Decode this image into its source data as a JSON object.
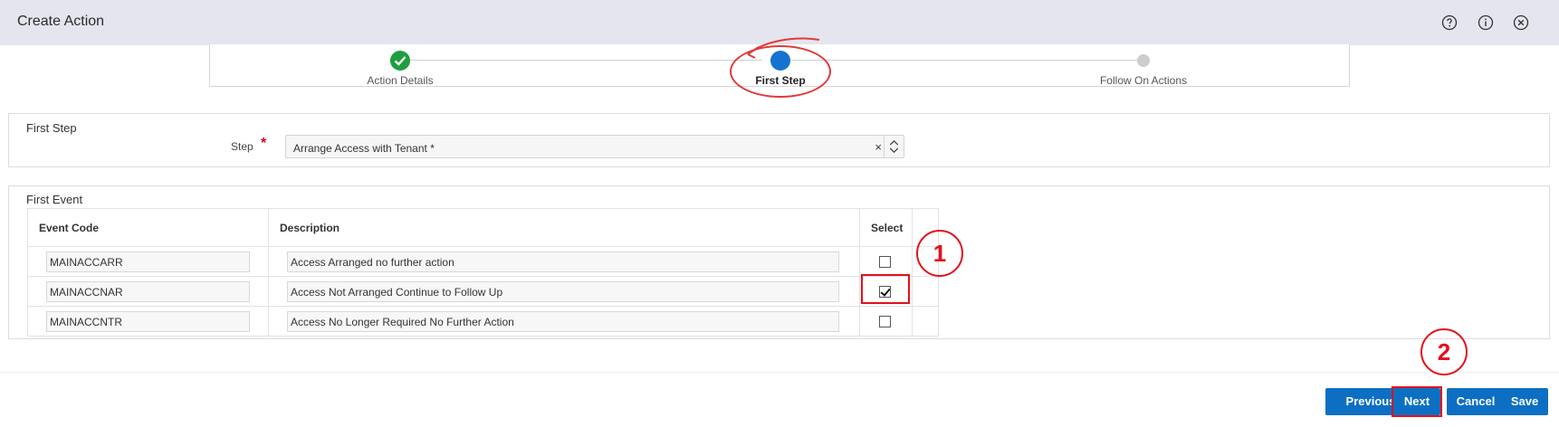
{
  "header": {
    "title": "Create Action",
    "icons": [
      "help-icon",
      "info-icon",
      "close-icon"
    ]
  },
  "train": {
    "stops": [
      {
        "label": "Action Details",
        "state": "completed",
        "icon": "check-icon"
      },
      {
        "label": "First Step",
        "state": "current"
      },
      {
        "label": "Follow On Actions",
        "state": "pending"
      }
    ]
  },
  "first_step": {
    "title": "First Step",
    "step_label": "Step",
    "required_mark": "*",
    "step_value": "Arrange Access with Tenant *",
    "clear_glyph": "×"
  },
  "first_event": {
    "title": "First Event",
    "columns": [
      "Event Code",
      "Description",
      "Select"
    ],
    "rows": [
      {
        "code": "MAINACCARR",
        "description": "Access Arranged no further action",
        "selected": false
      },
      {
        "code": "MAINACCNAR",
        "description": "Access Not Arranged Continue to Follow Up",
        "selected": true
      },
      {
        "code": "MAINACCNTR",
        "description": "Access No Longer Required No Further Action",
        "selected": false
      }
    ]
  },
  "annotations": {
    "callout_1": "1",
    "callout_2": "2",
    "color": "#e3101b"
  },
  "footer": {
    "previous_label": "Previous",
    "next_label": "Next",
    "cancel_label": "Cancel",
    "save_label": "Save"
  },
  "colors": {
    "header_bg": "#e4e5ee",
    "primary_button": "#0d6fc4",
    "completed_stop": "#1e9e3e",
    "current_stop": "#1473d1"
  }
}
